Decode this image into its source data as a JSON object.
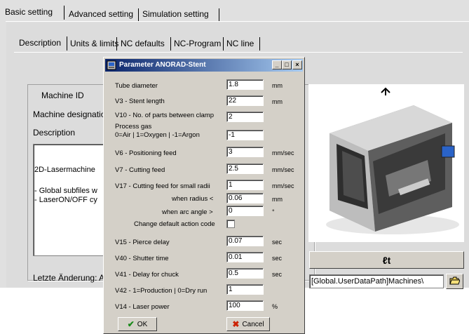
{
  "main_tabs": [
    {
      "label": "Basic setting"
    },
    {
      "label": "Advanced setting"
    },
    {
      "label": "Simulation setting"
    }
  ],
  "sub_tabs": [
    {
      "label": "Description"
    },
    {
      "label": "Units & limits"
    },
    {
      "label": "NC defaults"
    },
    {
      "label": "NC-Program"
    },
    {
      "label": "NC line"
    }
  ],
  "panel": {
    "machine_id_label": "Machine ID",
    "designation_label": "Machine designatio",
    "description_label": "Description",
    "description_lines": [
      "2D-Lasermachine",
      "- Global subfiles w",
      "- LaserON/OFF cy"
    ],
    "last_change_label": "Letzte Änderung: A",
    "path_value": "[Global.UserDataPath]Machines\\"
  },
  "dialog": {
    "title": "Parameter ANORAD-Stent",
    "params": [
      {
        "label": "Tube diameter",
        "value": "1.8",
        "unit": "mm"
      },
      {
        "label": "V3  - Stent length",
        "value": "22",
        "unit": "mm"
      },
      {
        "label": "V10 - No. of parts between clamp",
        "value": "2",
        "unit": ""
      },
      {
        "label_line1": "Process gas",
        "label_line2": "0=Air  |  1=Oxygen  |  -1=Argon",
        "value": "-1",
        "unit": ""
      },
      {
        "label": "V6  - Positioning feed",
        "value": "3",
        "unit": "mm/sec"
      },
      {
        "label": "V7  - Cutting feed",
        "value": "2.5",
        "unit": "mm/sec"
      },
      {
        "label": "V17 - Cutting feed for small radii",
        "value": "1",
        "unit": "mm/sec"
      },
      {
        "label": "when radius  <",
        "value": "0.06",
        "unit": "mm"
      },
      {
        "label": "when arc angle  >",
        "value": "0",
        "unit": "°"
      },
      {
        "label": "Change default action code",
        "checked": false
      },
      {
        "label": "V15 - Pierce delay",
        "value": "0.07",
        "unit": "sec"
      },
      {
        "label": "V40 - Shutter time",
        "value": "0.01",
        "unit": "sec"
      },
      {
        "label": "V41 - Delay for chuck",
        "value": "0.5",
        "unit": "sec"
      },
      {
        "label": "V42 - 1=Production | 0=Dry run",
        "value": "1",
        "unit": ""
      },
      {
        "label": "V14 - Laser power",
        "value": "100",
        "unit": "%"
      }
    ],
    "ok_label": "OK",
    "cancel_label": "Cancel"
  },
  "colors": {
    "title_gradient_start": "#0a246a",
    "title_gradient_end": "#a6caf0",
    "panel_bg": "#e0e0e0",
    "dialog_bg": "#d4d0c8",
    "ok_check": "#1a8a1a",
    "cancel_x": "#cc2200"
  },
  "icons": {
    "dialog_icon": "app-icon",
    "tool_button": "adjust-icon",
    "browse_button": "folder-open-icon"
  }
}
